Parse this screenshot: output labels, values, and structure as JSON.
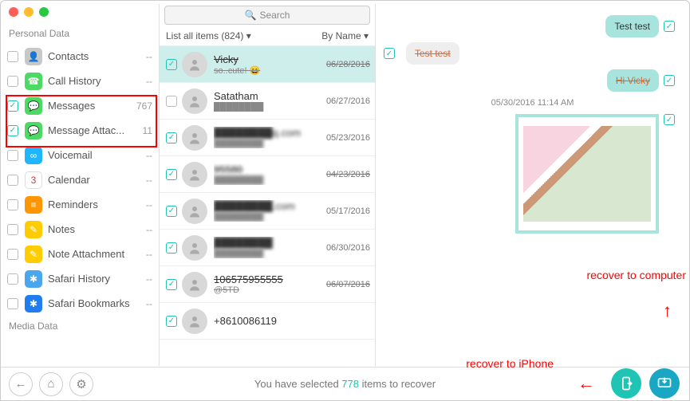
{
  "sidebar": {
    "section_personal": "Personal Data",
    "section_media": "Media Data",
    "items": [
      {
        "label": "Contacts",
        "count": "--",
        "checked": false,
        "icon": "👤",
        "bg": "#c8c8c8"
      },
      {
        "label": "Call History",
        "count": "--",
        "checked": false,
        "icon": "☎",
        "bg": "#4cd964"
      },
      {
        "label": "Messages",
        "count": "767",
        "checked": true,
        "icon": "💬",
        "bg": "#4cd964"
      },
      {
        "label": "Message Attac...",
        "count": "11",
        "checked": true,
        "icon": "💬",
        "bg": "#4cd964"
      },
      {
        "label": "Voicemail",
        "count": "--",
        "checked": false,
        "icon": "∞",
        "bg": "#1fb6ff"
      },
      {
        "label": "Calendar",
        "count": "--",
        "checked": false,
        "icon": "3",
        "bg": "#fff"
      },
      {
        "label": "Reminders",
        "count": "--",
        "checked": false,
        "icon": "≡",
        "bg": "#ff9500"
      },
      {
        "label": "Notes",
        "count": "--",
        "checked": false,
        "icon": "✎",
        "bg": "#ffcc00"
      },
      {
        "label": "Note Attachment",
        "count": "--",
        "checked": false,
        "icon": "✎",
        "bg": "#ffcc00"
      },
      {
        "label": "Safari History",
        "count": "--",
        "checked": false,
        "icon": "✱",
        "bg": "#4aa7ee"
      },
      {
        "label": "Safari Bookmarks",
        "count": "--",
        "checked": false,
        "icon": "✱",
        "bg": "#1f7def"
      }
    ]
  },
  "search_placeholder": "Search",
  "sort": {
    "left": "List all items (824)  ▾",
    "right": "By Name  ▾"
  },
  "threads": [
    {
      "name": "Vicky",
      "sub": "so..cute! 😄",
      "date": "06/28/2016",
      "checked": true,
      "selected": true,
      "strike": true,
      "avatar": "p1"
    },
    {
      "name": "Satatham",
      "sub": "████████",
      "date": "06/27/2016",
      "checked": false,
      "selected": false,
      "strike": false,
      "avatar": "p2"
    },
    {
      "name": "████████q.com",
      "sub": "████████",
      "date": "05/23/2016",
      "checked": true,
      "strike": false,
      "blur": true
    },
    {
      "name": "95580",
      "sub": "████████",
      "date": "04/23/2016",
      "checked": true,
      "strike": true,
      "blur": true
    },
    {
      "name": "████████.com",
      "sub": "████████",
      "date": "05/17/2016",
      "checked": true,
      "blur": true
    },
    {
      "name": "████████",
      "sub": "████████",
      "date": "06/30/2016",
      "checked": true,
      "blur": true
    },
    {
      "name": "106575955555",
      "sub": "@5TD",
      "date": "06/07/2016",
      "checked": true,
      "strike": true
    },
    {
      "name": "+8610086119",
      "sub": "",
      "date": "",
      "checked": true
    }
  ],
  "chat": {
    "msg1": "Test test",
    "msg2": "Test test",
    "msg3": "Hi Vicky",
    "timestamp": "05/30/2016 11:14 AM"
  },
  "callouts": {
    "to_iphone": "recover to iPhone",
    "to_computer": "recover to computer"
  },
  "footer": {
    "status_pre": "You have selected ",
    "status_num": "778",
    "status_post": " items to recover"
  }
}
